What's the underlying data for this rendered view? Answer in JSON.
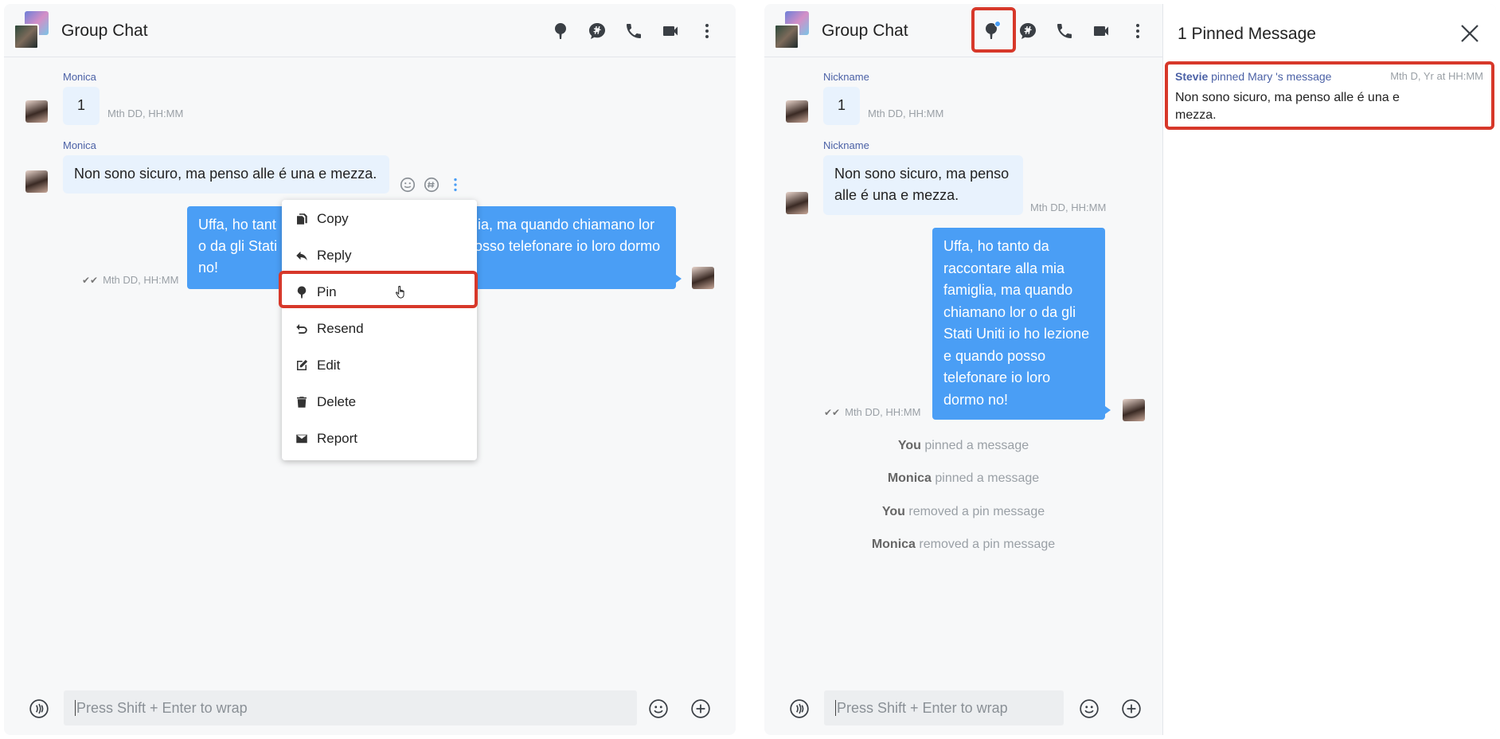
{
  "left_panel": {
    "title": "Group Chat",
    "messages": [
      {
        "sender": "Monica",
        "text": "1",
        "time": "Mth DD, HH:MM"
      },
      {
        "sender": "Monica",
        "text": "Non sono sicuro, ma penso alle é una e mezza."
      },
      {
        "text_line1": "Uffa, ho tant",
        "text_line1b": "lia, ma quando chiamano lor",
        "text_line2": "o da gli Stati",
        "text_line2b": "osso telefonare io loro dormo",
        "text_line3": "no!",
        "time": "Mth DD, HH:MM"
      }
    ],
    "context_menu": {
      "copy": "Copy",
      "reply": "Reply",
      "pin": "Pin",
      "resend": "Resend",
      "edit": "Edit",
      "delete": "Delete",
      "report": "Report"
    },
    "composer_placeholder": "Press Shift + Enter to wrap"
  },
  "right_panel": {
    "title": "Group Chat",
    "messages": [
      {
        "sender": "Nickname",
        "text": "1",
        "time": "Mth DD, HH:MM"
      },
      {
        "sender": "Nickname",
        "text_line1": "Non sono sicuro, ma penso",
        "text_line2": "alle é una e mezza.",
        "time": "Mth DD, HH:MM"
      },
      {
        "lines": [
          "Uffa, ho tanto da",
          "raccontare alla mia",
          "famiglia, ma quando",
          "chiamano lor o da gli",
          "Stati Uniti io ho lezione",
          "e quando posso",
          "telefonare io loro",
          "dormo no!"
        ],
        "time": "Mth DD, HH:MM"
      }
    ],
    "system_messages": [
      {
        "actor": "You",
        "action": "pinned a message"
      },
      {
        "actor": "Monica",
        "action": "pinned a message"
      },
      {
        "actor": "You",
        "action": "removed a pin message"
      },
      {
        "actor": "Monica",
        "action": "removed a pin message"
      }
    ],
    "composer_placeholder": "Press Shift + Enter to wrap"
  },
  "pinned_panel": {
    "title": "1 Pinned Message",
    "pinner": "Stevie",
    "pinned_word": "pinned",
    "author": "Mary",
    "suffix": "'s message",
    "time": "Mth D, Yr at HH:MM",
    "text_line1": "Non sono sicuro, ma penso alle é una e",
    "text_line2": "mezza."
  },
  "colors": {
    "accent": "#4a9ef5",
    "highlight": "#d7382a",
    "sender": "#4b61a6",
    "incoming_bubble": "#e8f2fd"
  }
}
